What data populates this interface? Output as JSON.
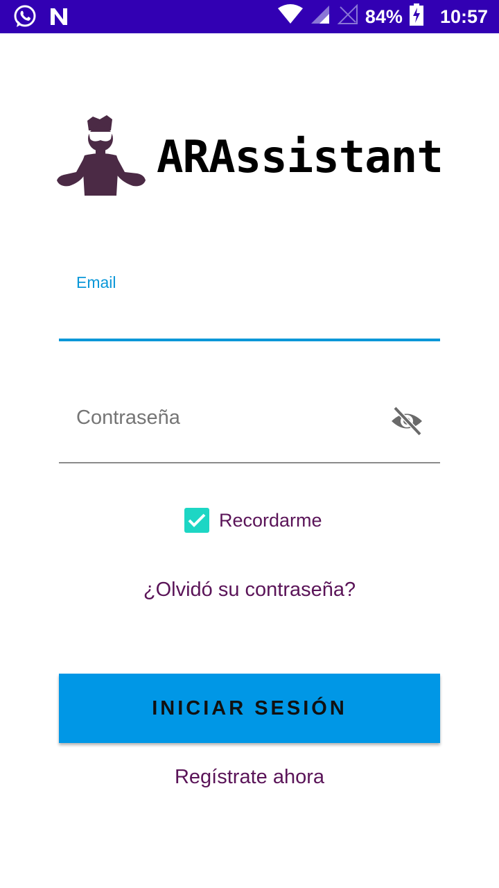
{
  "status_bar": {
    "battery": "84%",
    "time": "10:57",
    "background": "#3200b3",
    "icons": [
      "whatsapp-icon",
      "n-notification-icon",
      "wifi-icon",
      "signal-icon",
      "signal-empty-icon",
      "battery-charging-icon"
    ]
  },
  "logo": {
    "app_name": "ARAssistant",
    "mascot_color": "#4b2a45"
  },
  "form": {
    "email_label": "Email",
    "email_value": "",
    "password_placeholder": "Contraseña",
    "password_visibility_icon": "eye-off-icon",
    "remember_label": "Recordarme",
    "remember_checked": true,
    "forgot_link": "¿Olvidó su contraseña?",
    "login_button": "INICIAR SESIÓN",
    "register_link": "Regístrate ahora"
  },
  "colors": {
    "accent": "#0a97d8",
    "button": "#0097e6",
    "checkbox": "#1dd6c4",
    "link": "#5a1458"
  }
}
